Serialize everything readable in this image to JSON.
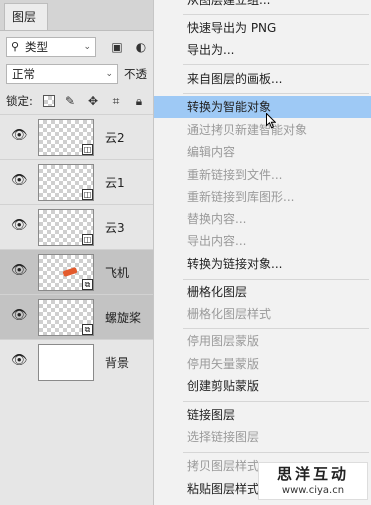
{
  "panel": {
    "tab_label": "图层",
    "filter_select": "类型",
    "blend_mode": "正常",
    "opacity_label": "不透",
    "lock_label": "锁定:"
  },
  "layers": [
    {
      "name": "云2",
      "kind": "smart-object",
      "selected": false
    },
    {
      "name": "云1",
      "kind": "smart-object",
      "selected": false
    },
    {
      "name": "云3",
      "kind": "smart-object",
      "selected": false
    },
    {
      "name": "飞机",
      "kind": "linked-smart-object",
      "selected": true
    },
    {
      "name": "螺旋桨",
      "kind": "linked-smart-object",
      "selected": true
    },
    {
      "name": "背景",
      "kind": "normal",
      "selected": false
    }
  ],
  "menu": {
    "top_partial": "从图层建立组...",
    "items": [
      {
        "label": "快速导出为 PNG",
        "enabled": true
      },
      {
        "label": "导出为...",
        "enabled": true
      },
      {
        "label": "来自图层的画板...",
        "enabled": true
      },
      {
        "label": "转换为智能对象",
        "enabled": true,
        "highlighted": true
      },
      {
        "label": "通过拷贝新建智能对象",
        "enabled": false
      },
      {
        "label": "编辑内容",
        "enabled": false
      },
      {
        "label": "重新链接到文件...",
        "enabled": false
      },
      {
        "label": "重新链接到库图形...",
        "enabled": false
      },
      {
        "label": "替换内容...",
        "enabled": false
      },
      {
        "label": "导出内容...",
        "enabled": false
      },
      {
        "label": "转换为链接对象...",
        "enabled": true
      },
      {
        "label": "栅格化图层",
        "enabled": true
      },
      {
        "label": "栅格化图层样式",
        "enabled": false
      },
      {
        "label": "停用图层蒙版",
        "enabled": false
      },
      {
        "label": "停用矢量蒙版",
        "enabled": false
      },
      {
        "label": "创建剪贴蒙版",
        "enabled": true
      },
      {
        "label": "链接图层",
        "enabled": true
      },
      {
        "label": "选择链接图层",
        "enabled": false
      },
      {
        "label": "拷贝图层样式",
        "enabled": false
      },
      {
        "label": "粘贴图层样式",
        "enabled": true
      }
    ]
  },
  "watermark": {
    "title": "思洋互动",
    "url": "www.ciya.cn"
  }
}
